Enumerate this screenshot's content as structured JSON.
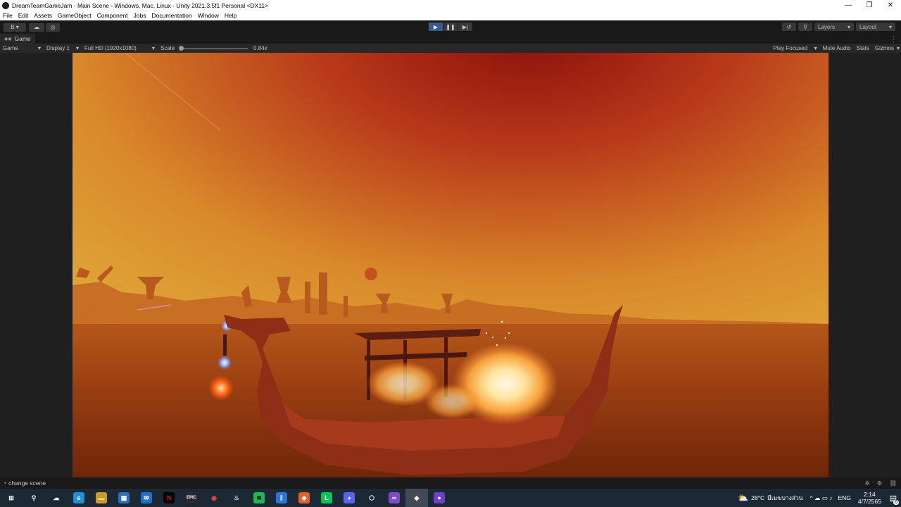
{
  "window": {
    "title": "DreamTeamGameJam - Main Scene - Windows, Mac, Linux - Unity 2021.3.5f1 Personal <DX11>",
    "min_glyph": "—",
    "max_glyph": "❐",
    "close_glyph": "✕"
  },
  "menu": [
    "File",
    "Edit",
    "Assets",
    "GameObject",
    "Component",
    "Jobs",
    "Documentation",
    "Window",
    "Help"
  ],
  "toolbar": {
    "account_label": "B ▾",
    "cloud_glyph": "☁",
    "collab_glyph": "◎",
    "play_glyph": "▶",
    "pause_glyph": "❚❚",
    "step_glyph": "▶|",
    "history_glyph": "↺",
    "search_glyph": "⚲",
    "layers_label": "Layers",
    "layout_label": "Layout"
  },
  "tab": {
    "icon_glyph": "◉◉",
    "label": "Game"
  },
  "gamebar": {
    "mode": "Game",
    "display": "Display 1",
    "resolution": "Full HD (1920x1080)",
    "scale_label": "Scale",
    "scale_value": "0.84x",
    "scale_level": 0.0,
    "play_focused": "Play Focused",
    "mute_audio": "Mute Audio",
    "stats": "Stats",
    "gizmos": "Gizmos"
  },
  "status": {
    "message": "change scene"
  },
  "taskbar": {
    "apps": [
      {
        "name": "windows-start-icon",
        "glyph": "⊞",
        "color": "#ffffff",
        "bg": "transparent"
      },
      {
        "name": "search-icon",
        "glyph": "⚲",
        "color": "#ffffff",
        "bg": "transparent"
      },
      {
        "name": "cloud-app-icon",
        "glyph": "☁",
        "color": "#ffffff",
        "bg": "transparent"
      },
      {
        "name": "edge-icon",
        "glyph": "e",
        "color": "#ffffff",
        "bg": "#1f8fd6"
      },
      {
        "name": "file-explorer-icon",
        "glyph": "▬",
        "color": "#ffd35c",
        "bg": "#c99a2e"
      },
      {
        "name": "store-icon",
        "glyph": "▦",
        "color": "#ffffff",
        "bg": "#2f6fb8"
      },
      {
        "name": "mail-icon",
        "glyph": "✉",
        "color": "#ffffff",
        "bg": "#1e70c8"
      },
      {
        "name": "netflix-icon",
        "glyph": "N",
        "color": "#e50914",
        "bg": "#000000"
      },
      {
        "name": "epic-games-icon",
        "glyph": "EPIC",
        "color": "#ffffff",
        "bg": "#2b2b2b"
      },
      {
        "name": "chrome-icon",
        "glyph": "◉",
        "color": "#e8453c",
        "bg": "transparent"
      },
      {
        "name": "steam-icon",
        "glyph": "♨",
        "color": "#c7d5e0",
        "bg": "#1b2838"
      },
      {
        "name": "spotify-icon",
        "glyph": "≋",
        "color": "#000000",
        "bg": "#1db954"
      },
      {
        "name": "bluetooth-app-icon",
        "glyph": "ᛒ",
        "color": "#ffffff",
        "bg": "#2a73d8"
      },
      {
        "name": "maps-app-icon",
        "glyph": "◆",
        "color": "#ffffff",
        "bg": "#e0602a"
      },
      {
        "name": "line-icon",
        "glyph": "L",
        "color": "#ffffff",
        "bg": "#06c755"
      },
      {
        "name": "discord-icon",
        "glyph": "◕",
        "color": "#ffffff",
        "bg": "#5865f2"
      },
      {
        "name": "unity-hub-icon",
        "glyph": "⬡",
        "color": "#ffffff",
        "bg": "transparent"
      },
      {
        "name": "visual-studio-icon",
        "glyph": "∞",
        "color": "#ffffff",
        "bg": "#7d4bc4"
      },
      {
        "name": "unity-editor-icon",
        "glyph": "◈",
        "color": "#ffffff",
        "bg": "#4a4a4a"
      },
      {
        "name": "github-icon",
        "glyph": "●",
        "color": "#ffffff",
        "bg": "#6e40c9"
      }
    ],
    "weather_glyph": "⛅",
    "temperature": "28°C",
    "weather_text": "มีเมฆบางส่วน",
    "tray_glyphs": "^ ☁ ▭ ♪",
    "language": "ENG",
    "time": "2:14",
    "date": "4/7/2565",
    "notification_count": "6"
  }
}
